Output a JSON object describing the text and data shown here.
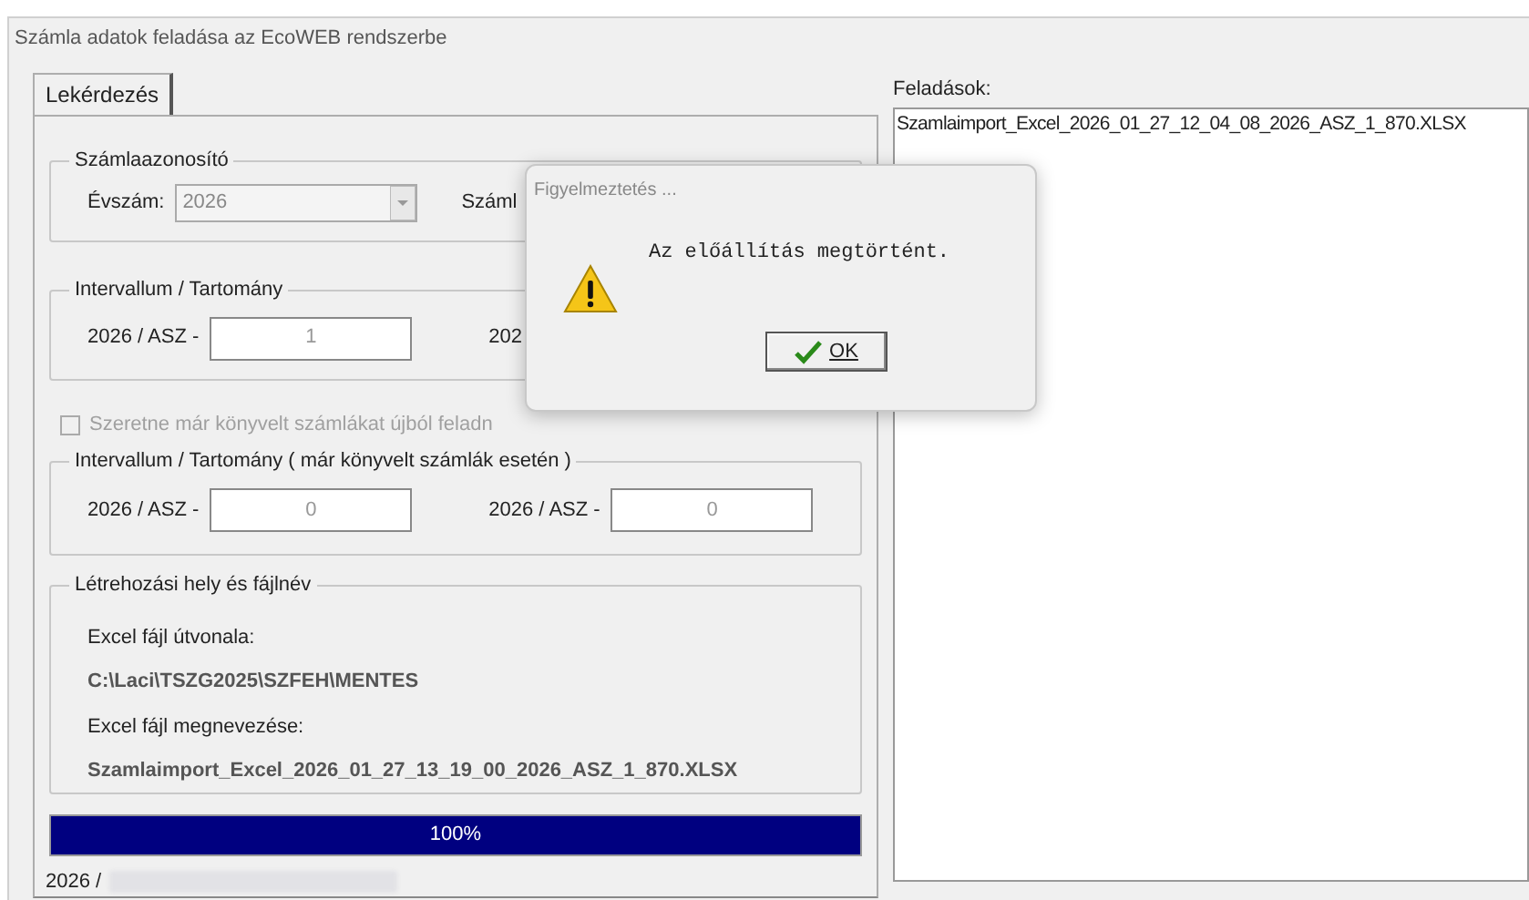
{
  "window": {
    "title": "Számla adatok feladása az EcoWEB rendszerbe"
  },
  "tabs": [
    {
      "label": "Lekérdezés",
      "selected": true
    }
  ],
  "invoice_id_group": {
    "title": "Számlaazonosító",
    "year_label": "Évszám:",
    "year_value": "2026",
    "year_disabled": true,
    "partial_label": "Száml"
  },
  "interval_group": {
    "title": "Intervallum / Tartomány",
    "from_label": "2026 / ASZ -",
    "from_value": "1",
    "to_label_partial": "202"
  },
  "resend_checkbox": {
    "label": "Szeretne már könyvelt számlákat újból feladn",
    "checked": false,
    "disabled": true
  },
  "booked_interval_group": {
    "title": "Intervallum / Tartomány ( már könyvelt számlák esetén )",
    "from_label": "2026 / ASZ -",
    "from_value": "0",
    "to_label": "2026 / ASZ -",
    "to_value": "0"
  },
  "file_group": {
    "title": "Létrehozási hely és fájlnév",
    "path_label": "Excel fájl útvonala:",
    "path_value": "C:\\Laci\\TSZG2025\\SZFEH\\MENTES",
    "name_label": "Excel fájl megnevezése:",
    "name_value": "Szamlaimport_Excel_2026_01_27_13_19_00_2026_ASZ_1_870.XLSX"
  },
  "progress": {
    "level": 1,
    "label": "100%"
  },
  "status_text": "2026 /",
  "uploads": {
    "title": "Feladások:",
    "items": [
      "Szamlaimport_Excel_2026_01_27_12_04_08_2026_ASZ_1_870.XLSX"
    ]
  },
  "dialog": {
    "title": "Figyelmeztetés ...",
    "message": "Az előállítás megtörtént.",
    "ok_button": "OK"
  }
}
